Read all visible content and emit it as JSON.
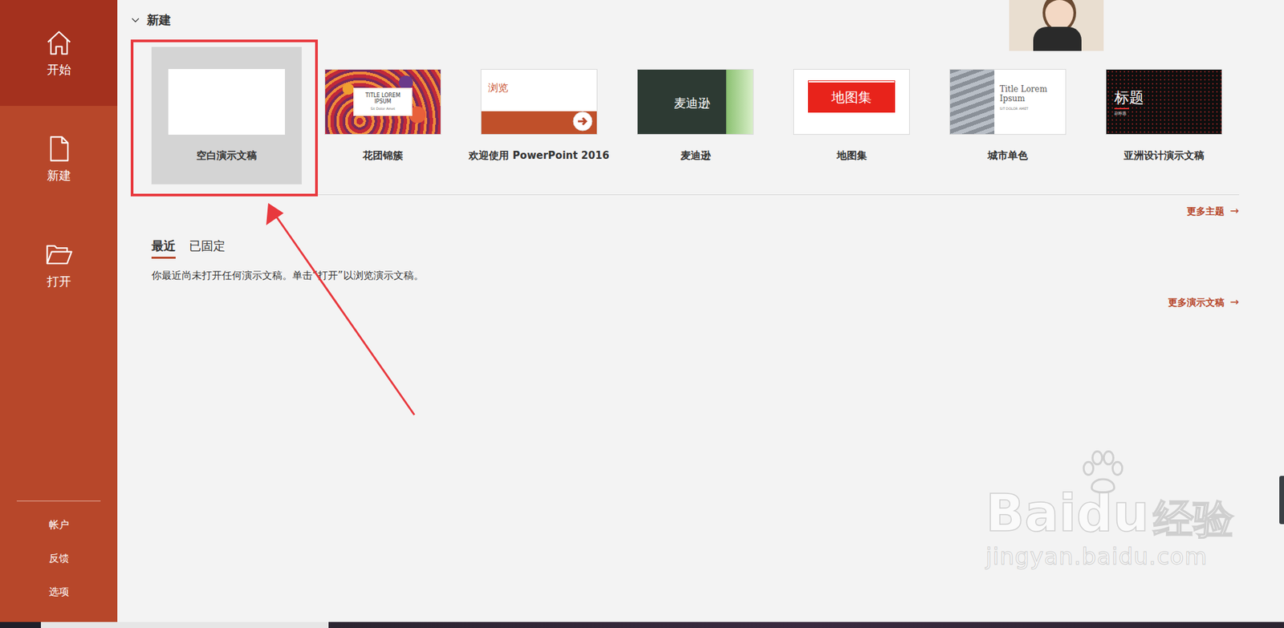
{
  "sidebar": {
    "items": [
      {
        "label": "开始",
        "selected": true
      },
      {
        "label": "新建",
        "selected": false
      },
      {
        "label": "打开",
        "selected": false
      }
    ],
    "footer": [
      "帐户",
      "反馈",
      "选项"
    ]
  },
  "new_section": {
    "title": "新建",
    "expanded": true,
    "templates": [
      {
        "kind": "blank",
        "label": "空白演示文稿",
        "selected": true
      },
      {
        "kind": "floral",
        "label": "花团锦簇",
        "selected": false,
        "title": "TITLE LOREM IPSUM",
        "subtitle": "Sit Dolor Amet"
      },
      {
        "kind": "welcome",
        "label": "欢迎使用 PowerPoint 2016",
        "selected": false,
        "title": "浏览"
      },
      {
        "kind": "madison",
        "label": "麦迪逊",
        "selected": false,
        "title": "麦迪逊"
      },
      {
        "kind": "atlas",
        "label": "地图集",
        "selected": false,
        "title": "地图集"
      },
      {
        "kind": "city",
        "label": "城市单色",
        "selected": false,
        "title": "Title Lorem Ipsum",
        "subtitle": "SIT DOLOR AMET"
      },
      {
        "kind": "asia",
        "label": "亚洲设计演示文稿",
        "selected": false,
        "title": "标题",
        "subtitle": "副标题"
      }
    ],
    "more": "更多主题",
    "more_icon": "→"
  },
  "recent": {
    "tabs": [
      {
        "label": "最近",
        "selected": true
      },
      {
        "label": "已固定",
        "selected": false
      }
    ],
    "message": "你最近尚未打开任何演示文稿。单击“打开”以浏览演示文稿。",
    "more": "更多演示文稿",
    "more_icon": "→"
  },
  "watermark": {
    "parts": [
      "Bai",
      "du",
      "经验"
    ],
    "url": "jingyan.baidu.com"
  }
}
